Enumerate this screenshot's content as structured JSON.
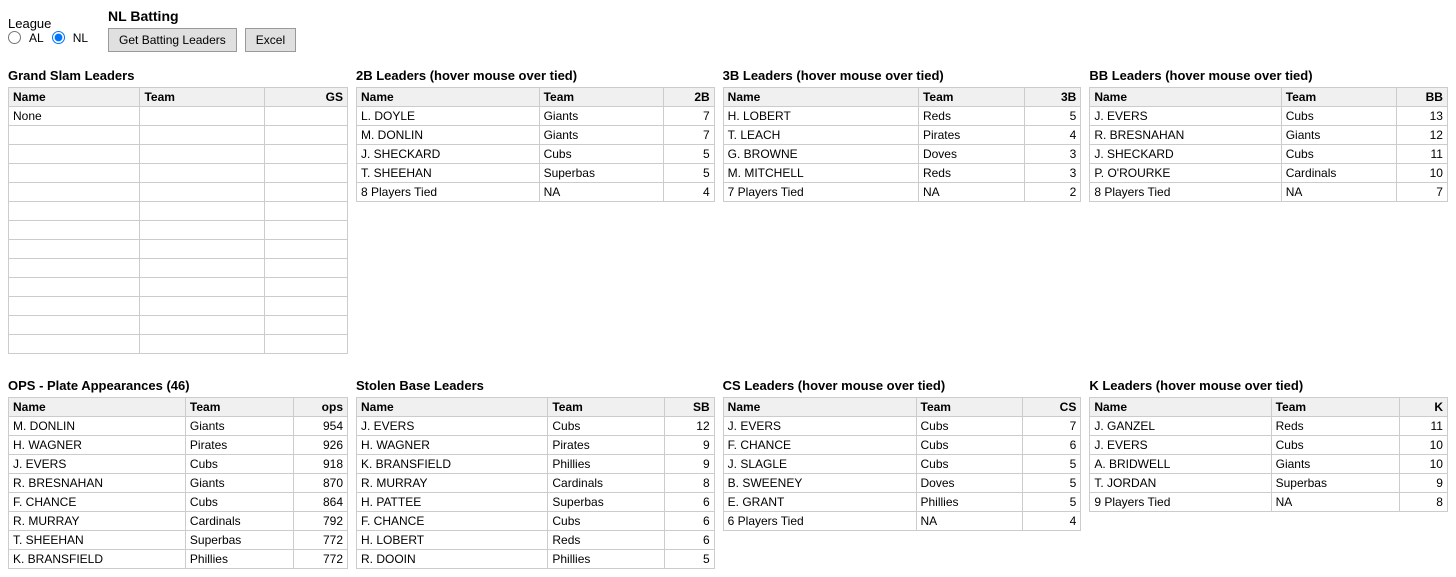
{
  "league": {
    "label": "League",
    "options": [
      "AL",
      "NL"
    ],
    "selected": "NL"
  },
  "nl_batting": {
    "label": "NL Batting",
    "get_button": "Get Batting Leaders",
    "excel_button": "Excel"
  },
  "grand_slam": {
    "title": "Grand Slam Leaders",
    "columns": [
      "Name",
      "Team",
      "GS"
    ],
    "rows": [
      {
        "name": "None",
        "team": "",
        "gs": ""
      }
    ]
  },
  "leaders_2b": {
    "title": "2B Leaders (hover mouse over tied)",
    "columns": [
      "Name",
      "Team",
      "2B"
    ],
    "rows": [
      {
        "name": "L. DOYLE",
        "team": "Giants",
        "val": "7"
      },
      {
        "name": "M. DONLIN",
        "team": "Giants",
        "val": "7"
      },
      {
        "name": "J. SHECKARD",
        "team": "Cubs",
        "val": "5"
      },
      {
        "name": "T. SHEEHAN",
        "team": "Superbas",
        "val": "5"
      },
      {
        "name": "8 Players Tied",
        "team": "NA",
        "val": "4"
      }
    ]
  },
  "leaders_3b": {
    "title": "3B Leaders (hover mouse over tied)",
    "columns": [
      "Name",
      "Team",
      "3B"
    ],
    "rows": [
      {
        "name": "H. LOBERT",
        "team": "Reds",
        "val": "5"
      },
      {
        "name": "T. LEACH",
        "team": "Pirates",
        "val": "4"
      },
      {
        "name": "G. BROWNE",
        "team": "Doves",
        "val": "3"
      },
      {
        "name": "M. MITCHELL",
        "team": "Reds",
        "val": "3"
      },
      {
        "name": "7 Players Tied",
        "team": "NA",
        "val": "2"
      }
    ]
  },
  "leaders_bb": {
    "title": "BB Leaders (hover mouse over tied)",
    "columns": [
      "Name",
      "Team",
      "BB"
    ],
    "rows": [
      {
        "name": "J. EVERS",
        "team": "Cubs",
        "val": "13"
      },
      {
        "name": "R. BRESNAHAN",
        "team": "Giants",
        "val": "12"
      },
      {
        "name": "J. SHECKARD",
        "team": "Cubs",
        "val": "11"
      },
      {
        "name": "P. O'ROURKE",
        "team": "Cardinals",
        "val": "10"
      },
      {
        "name": "8 Players Tied",
        "team": "NA",
        "val": "7"
      }
    ]
  },
  "ops": {
    "title": "OPS - Plate Appearances (46)",
    "columns": [
      "Name",
      "Team",
      "ops"
    ],
    "rows": [
      {
        "name": "M. DONLIN",
        "team": "Giants",
        "val": "954"
      },
      {
        "name": "H. WAGNER",
        "team": "Pirates",
        "val": "926"
      },
      {
        "name": "J. EVERS",
        "team": "Cubs",
        "val": "918"
      },
      {
        "name": "R. BRESNAHAN",
        "team": "Giants",
        "val": "870"
      },
      {
        "name": "F. CHANCE",
        "team": "Cubs",
        "val": "864"
      },
      {
        "name": "R. MURRAY",
        "team": "Cardinals",
        "val": "792"
      },
      {
        "name": "T. SHEEHAN",
        "team": "Superbas",
        "val": "772"
      },
      {
        "name": "K. BRANSFIELD",
        "team": "Phillies",
        "val": "772"
      }
    ]
  },
  "sb": {
    "title": "Stolen Base Leaders",
    "columns": [
      "Name",
      "Team",
      "SB"
    ],
    "rows": [
      {
        "name": "J. EVERS",
        "team": "Cubs",
        "val": "12"
      },
      {
        "name": "H. WAGNER",
        "team": "Pirates",
        "val": "9"
      },
      {
        "name": "K. BRANSFIELD",
        "team": "Phillies",
        "val": "9"
      },
      {
        "name": "R. MURRAY",
        "team": "Cardinals",
        "val": "8"
      },
      {
        "name": "H. PATTEE",
        "team": "Superbas",
        "val": "6"
      },
      {
        "name": "F. CHANCE",
        "team": "Cubs",
        "val": "6"
      },
      {
        "name": "H. LOBERT",
        "team": "Reds",
        "val": "6"
      },
      {
        "name": "R. DOOIN",
        "team": "Phillies",
        "val": "5"
      }
    ]
  },
  "cs": {
    "title": "CS Leaders (hover mouse over tied)",
    "columns": [
      "Name",
      "Team",
      "CS"
    ],
    "rows": [
      {
        "name": "J. EVERS",
        "team": "Cubs",
        "val": "7"
      },
      {
        "name": "F. CHANCE",
        "team": "Cubs",
        "val": "6"
      },
      {
        "name": "J. SLAGLE",
        "team": "Cubs",
        "val": "5"
      },
      {
        "name": "B. SWEENEY",
        "team": "Doves",
        "val": "5"
      },
      {
        "name": "E. GRANT",
        "team": "Phillies",
        "val": "5"
      },
      {
        "name": "6 Players Tied",
        "team": "NA",
        "val": "4"
      }
    ]
  },
  "k": {
    "title": "K Leaders (hover mouse over tied)",
    "columns": [
      "Name",
      "Team",
      "K"
    ],
    "rows": [
      {
        "name": "J. GANZEL",
        "team": "Reds",
        "val": "11"
      },
      {
        "name": "J. EVERS",
        "team": "Cubs",
        "val": "10"
      },
      {
        "name": "A. BRIDWELL",
        "team": "Giants",
        "val": "10"
      },
      {
        "name": "T. JORDAN",
        "team": "Superbas",
        "val": "9"
      },
      {
        "name": "9 Players Tied",
        "team": "NA",
        "val": "8"
      }
    ]
  }
}
